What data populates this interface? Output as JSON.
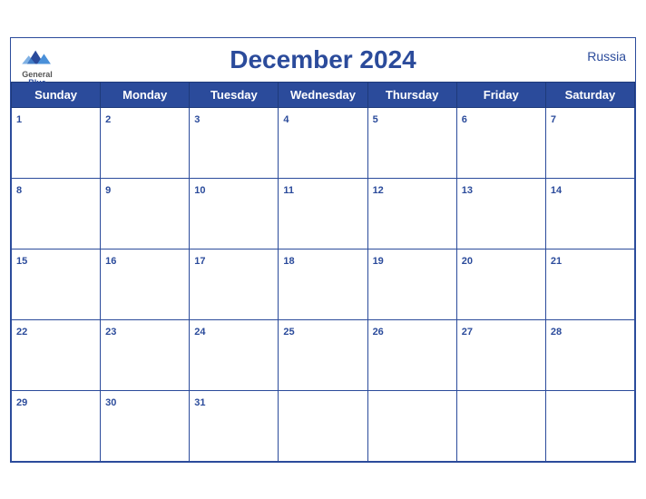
{
  "header": {
    "title": "December 2024",
    "brand_general": "General",
    "brand_blue": "Blue",
    "country": "Russia"
  },
  "weekdays": [
    "Sunday",
    "Monday",
    "Tuesday",
    "Wednesday",
    "Thursday",
    "Friday",
    "Saturday"
  ],
  "weeks": [
    [
      "1",
      "2",
      "3",
      "4",
      "5",
      "6",
      "7"
    ],
    [
      "8",
      "9",
      "10",
      "11",
      "12",
      "13",
      "14"
    ],
    [
      "15",
      "16",
      "17",
      "18",
      "19",
      "20",
      "21"
    ],
    [
      "22",
      "23",
      "24",
      "25",
      "26",
      "27",
      "28"
    ],
    [
      "29",
      "30",
      "31",
      "",
      "",
      "",
      ""
    ]
  ]
}
